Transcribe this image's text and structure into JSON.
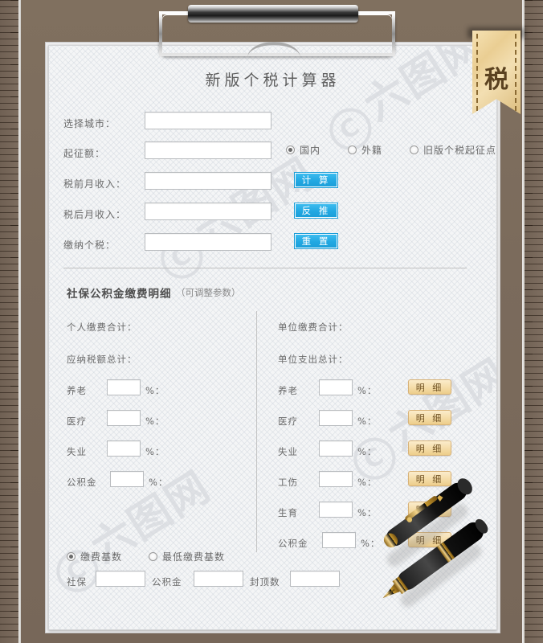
{
  "window": {
    "title": "新版个税计算器",
    "ribbon_char": "税",
    "watermark": "六图网"
  },
  "colors": {
    "board": "#7b6b5c",
    "paper": "#f4f5f6",
    "button_blue": "#22a8e2",
    "button_tan": "#f6dfae",
    "ribbon": "#eace93",
    "text": "#6b6b6b"
  },
  "form": {
    "rows": [
      {
        "label": "选择城市：",
        "value": "",
        "placeholder": ""
      },
      {
        "label": "起征额：",
        "value": "",
        "placeholder": ""
      },
      {
        "label": "税前月收入：",
        "value": "",
        "placeholder": ""
      },
      {
        "label": "税后月收入：",
        "value": "",
        "placeholder": ""
      },
      {
        "label": "缴纳个税：",
        "value": "",
        "placeholder": ""
      }
    ],
    "radios": [
      {
        "label": "国内",
        "checked": true
      },
      {
        "label": "外籍",
        "checked": false
      },
      {
        "label": "旧版个税起征点",
        "checked": false
      }
    ],
    "buttons": [
      {
        "label": "计 算"
      },
      {
        "label": "反 推"
      },
      {
        "label": "重 置"
      }
    ]
  },
  "section": {
    "title": "社保公积金缴费明细",
    "subtitle": "（可调整参数）",
    "personal": {
      "totals": [
        {
          "label": "个人缴费合计：",
          "value": ""
        },
        {
          "label": "应纳税额总计：",
          "value": ""
        }
      ],
      "items": [
        {
          "label": "养老",
          "value": "",
          "unit": "%："
        },
        {
          "label": "医疗",
          "value": "",
          "unit": "%："
        },
        {
          "label": "失业",
          "value": "",
          "unit": "%："
        },
        {
          "label": "公积金",
          "value": "",
          "unit": "%："
        }
      ]
    },
    "company": {
      "totals": [
        {
          "label": "单位缴费合计：",
          "value": ""
        },
        {
          "label": "单位支出总计：",
          "value": ""
        }
      ],
      "items": [
        {
          "label": "养老",
          "value": "",
          "unit": "%：",
          "detail": "明 细"
        },
        {
          "label": "医疗",
          "value": "",
          "unit": "%：",
          "detail": "明 细"
        },
        {
          "label": "失业",
          "value": "",
          "unit": "%：",
          "detail": "明 细"
        },
        {
          "label": "工伤",
          "value": "",
          "unit": "%：",
          "detail": "明 细"
        },
        {
          "label": "生育",
          "value": "",
          "unit": "%：",
          "detail": "明 细"
        },
        {
          "label": "公积金",
          "value": "",
          "unit": "%：",
          "detail": "明 细"
        }
      ]
    }
  },
  "base": {
    "radios": [
      {
        "label": "缴费基数",
        "checked": true
      },
      {
        "label": "最低缴费基数",
        "checked": false
      }
    ],
    "fields": [
      {
        "label": "社保",
        "value": ""
      },
      {
        "label": "公积金",
        "value": ""
      },
      {
        "label": "封顶数",
        "value": ""
      }
    ]
  }
}
